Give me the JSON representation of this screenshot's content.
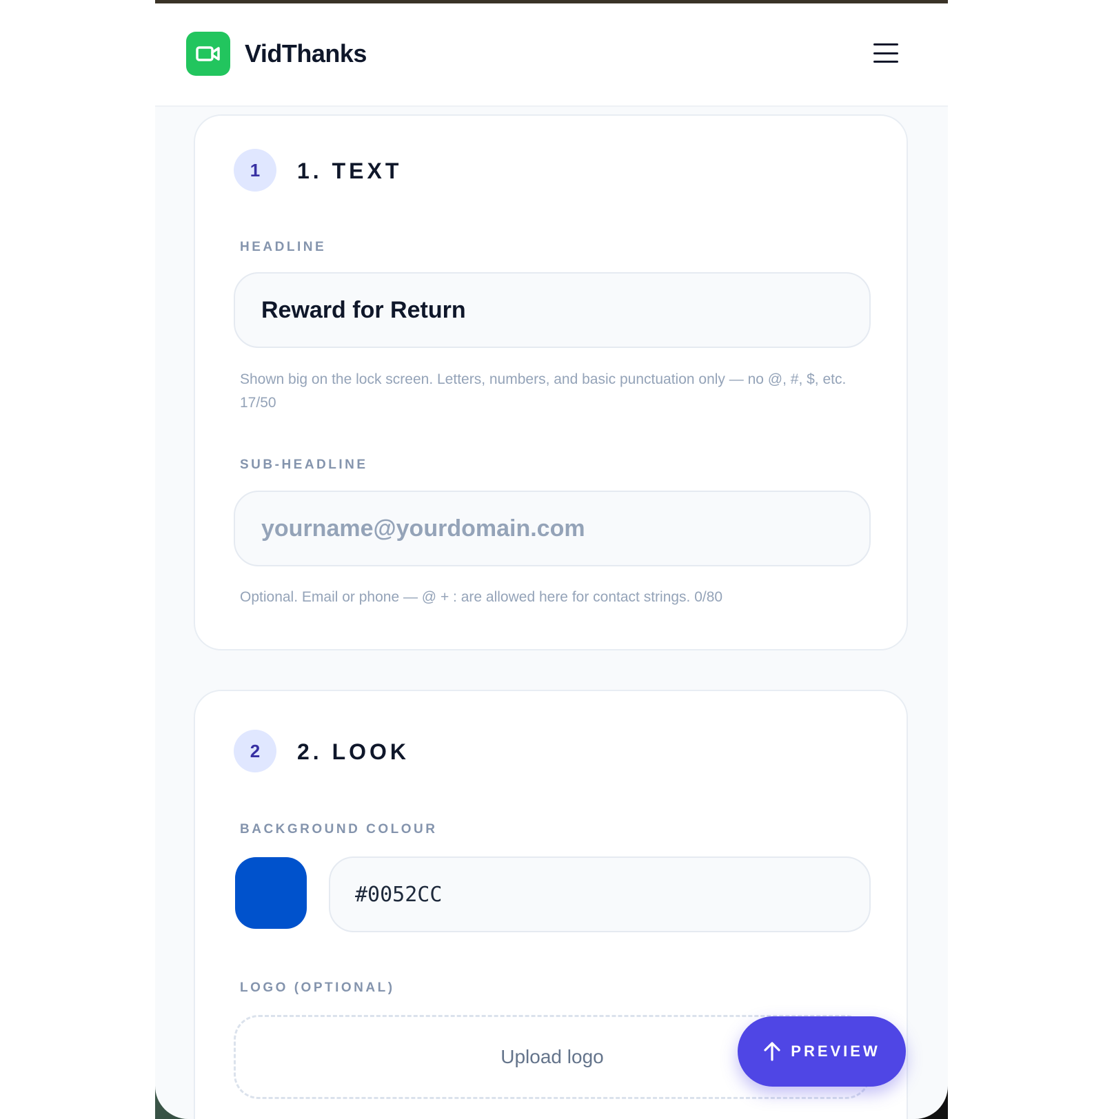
{
  "app": {
    "name": "VidThanks",
    "logo_icon": "video-camera-icon",
    "brand_color": "#22c55e",
    "menu_icon": "hamburger-menu-icon"
  },
  "sections": {
    "text": {
      "step_number": "1",
      "title": "1. TEXT",
      "headline": {
        "label": "HEADLINE",
        "value": "Reward for Return",
        "helper": "Shown big on the lock screen. Letters, numbers, and basic punctuation only — no @, #, $, etc. 17/50"
      },
      "subheadline": {
        "label": "SUB-HEADLINE",
        "value": "",
        "placeholder": "yourname@yourdomain.com",
        "helper": "Optional. Email or phone — @ + : are allowed here for contact strings. 0/80"
      }
    },
    "look": {
      "step_number": "2",
      "title": "2. LOOK",
      "background": {
        "label": "BACKGROUND COLOUR",
        "value": "#0052CC",
        "swatch_color": "#0052cc"
      },
      "logo": {
        "label": "LOGO (OPTIONAL)",
        "upload_label": "Upload logo"
      }
    }
  },
  "preview_button": {
    "label": "PREVIEW",
    "icon": "arrow-up-icon",
    "color": "#4f46e5"
  }
}
